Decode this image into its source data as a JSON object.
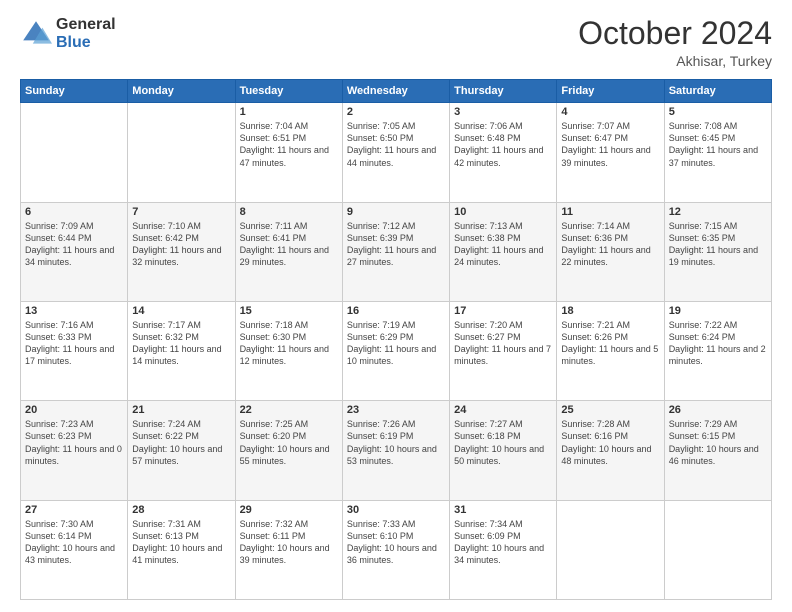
{
  "header": {
    "logo_general": "General",
    "logo_blue": "Blue",
    "month_title": "October 2024",
    "subtitle": "Akhisar, Turkey"
  },
  "days_of_week": [
    "Sunday",
    "Monday",
    "Tuesday",
    "Wednesday",
    "Thursday",
    "Friday",
    "Saturday"
  ],
  "weeks": [
    [
      {
        "day": "",
        "info": ""
      },
      {
        "day": "",
        "info": ""
      },
      {
        "day": "1",
        "info": "Sunrise: 7:04 AM\nSunset: 6:51 PM\nDaylight: 11 hours and 47 minutes."
      },
      {
        "day": "2",
        "info": "Sunrise: 7:05 AM\nSunset: 6:50 PM\nDaylight: 11 hours and 44 minutes."
      },
      {
        "day": "3",
        "info": "Sunrise: 7:06 AM\nSunset: 6:48 PM\nDaylight: 11 hours and 42 minutes."
      },
      {
        "day": "4",
        "info": "Sunrise: 7:07 AM\nSunset: 6:47 PM\nDaylight: 11 hours and 39 minutes."
      },
      {
        "day": "5",
        "info": "Sunrise: 7:08 AM\nSunset: 6:45 PM\nDaylight: 11 hours and 37 minutes."
      }
    ],
    [
      {
        "day": "6",
        "info": "Sunrise: 7:09 AM\nSunset: 6:44 PM\nDaylight: 11 hours and 34 minutes."
      },
      {
        "day": "7",
        "info": "Sunrise: 7:10 AM\nSunset: 6:42 PM\nDaylight: 11 hours and 32 minutes."
      },
      {
        "day": "8",
        "info": "Sunrise: 7:11 AM\nSunset: 6:41 PM\nDaylight: 11 hours and 29 minutes."
      },
      {
        "day": "9",
        "info": "Sunrise: 7:12 AM\nSunset: 6:39 PM\nDaylight: 11 hours and 27 minutes."
      },
      {
        "day": "10",
        "info": "Sunrise: 7:13 AM\nSunset: 6:38 PM\nDaylight: 11 hours and 24 minutes."
      },
      {
        "day": "11",
        "info": "Sunrise: 7:14 AM\nSunset: 6:36 PM\nDaylight: 11 hours and 22 minutes."
      },
      {
        "day": "12",
        "info": "Sunrise: 7:15 AM\nSunset: 6:35 PM\nDaylight: 11 hours and 19 minutes."
      }
    ],
    [
      {
        "day": "13",
        "info": "Sunrise: 7:16 AM\nSunset: 6:33 PM\nDaylight: 11 hours and 17 minutes."
      },
      {
        "day": "14",
        "info": "Sunrise: 7:17 AM\nSunset: 6:32 PM\nDaylight: 11 hours and 14 minutes."
      },
      {
        "day": "15",
        "info": "Sunrise: 7:18 AM\nSunset: 6:30 PM\nDaylight: 11 hours and 12 minutes."
      },
      {
        "day": "16",
        "info": "Sunrise: 7:19 AM\nSunset: 6:29 PM\nDaylight: 11 hours and 10 minutes."
      },
      {
        "day": "17",
        "info": "Sunrise: 7:20 AM\nSunset: 6:27 PM\nDaylight: 11 hours and 7 minutes."
      },
      {
        "day": "18",
        "info": "Sunrise: 7:21 AM\nSunset: 6:26 PM\nDaylight: 11 hours and 5 minutes."
      },
      {
        "day": "19",
        "info": "Sunrise: 7:22 AM\nSunset: 6:24 PM\nDaylight: 11 hours and 2 minutes."
      }
    ],
    [
      {
        "day": "20",
        "info": "Sunrise: 7:23 AM\nSunset: 6:23 PM\nDaylight: 11 hours and 0 minutes."
      },
      {
        "day": "21",
        "info": "Sunrise: 7:24 AM\nSunset: 6:22 PM\nDaylight: 10 hours and 57 minutes."
      },
      {
        "day": "22",
        "info": "Sunrise: 7:25 AM\nSunset: 6:20 PM\nDaylight: 10 hours and 55 minutes."
      },
      {
        "day": "23",
        "info": "Sunrise: 7:26 AM\nSunset: 6:19 PM\nDaylight: 10 hours and 53 minutes."
      },
      {
        "day": "24",
        "info": "Sunrise: 7:27 AM\nSunset: 6:18 PM\nDaylight: 10 hours and 50 minutes."
      },
      {
        "day": "25",
        "info": "Sunrise: 7:28 AM\nSunset: 6:16 PM\nDaylight: 10 hours and 48 minutes."
      },
      {
        "day": "26",
        "info": "Sunrise: 7:29 AM\nSunset: 6:15 PM\nDaylight: 10 hours and 46 minutes."
      }
    ],
    [
      {
        "day": "27",
        "info": "Sunrise: 7:30 AM\nSunset: 6:14 PM\nDaylight: 10 hours and 43 minutes."
      },
      {
        "day": "28",
        "info": "Sunrise: 7:31 AM\nSunset: 6:13 PM\nDaylight: 10 hours and 41 minutes."
      },
      {
        "day": "29",
        "info": "Sunrise: 7:32 AM\nSunset: 6:11 PM\nDaylight: 10 hours and 39 minutes."
      },
      {
        "day": "30",
        "info": "Sunrise: 7:33 AM\nSunset: 6:10 PM\nDaylight: 10 hours and 36 minutes."
      },
      {
        "day": "31",
        "info": "Sunrise: 7:34 AM\nSunset: 6:09 PM\nDaylight: 10 hours and 34 minutes."
      },
      {
        "day": "",
        "info": ""
      },
      {
        "day": "",
        "info": ""
      }
    ]
  ]
}
